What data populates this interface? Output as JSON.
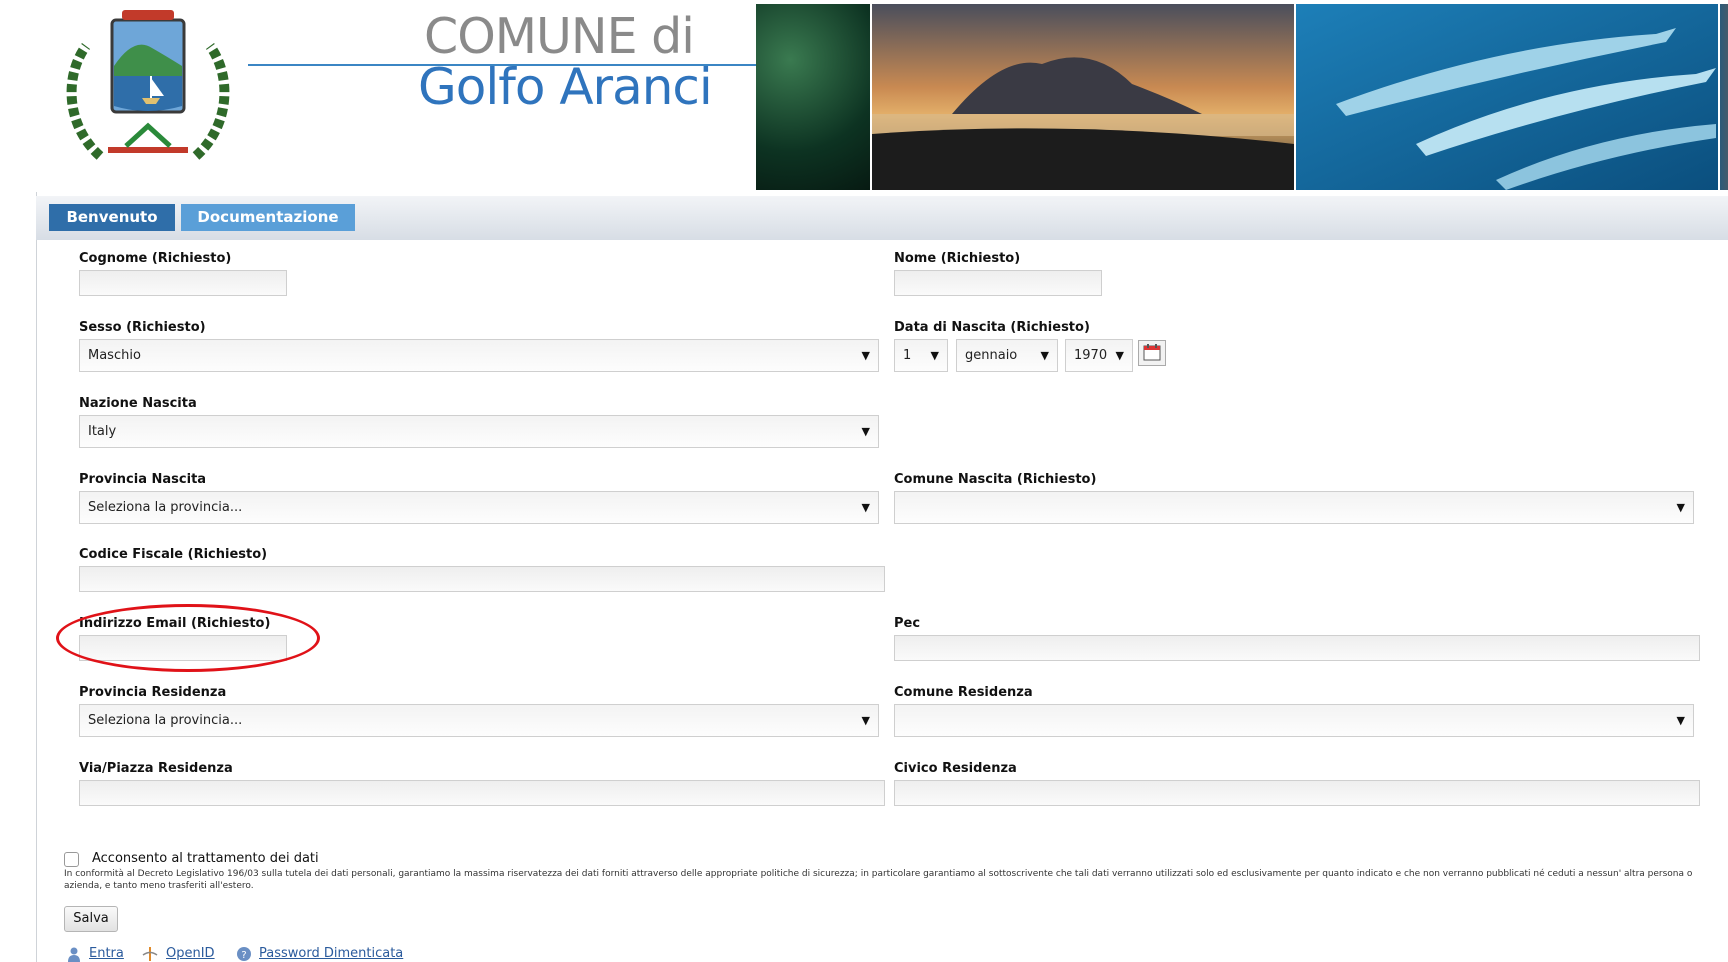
{
  "header": {
    "title_line1": "COMUNE di",
    "title_line2": "Golfo Aranci"
  },
  "nav": {
    "tabs": [
      {
        "label": "Benvenuto"
      },
      {
        "label": "Documentazione"
      }
    ]
  },
  "form": {
    "cognome_label": "Cognome (Richiesto)",
    "nome_label": "Nome (Richiesto)",
    "sesso_label": "Sesso (Richiesto)",
    "sesso_value": "Maschio",
    "data_nascita_label": "Data di Nascita (Richiesto)",
    "giorno_value": "1",
    "mese_value": "gennaio",
    "anno_value": "1970",
    "nazione_label": "Nazione Nascita",
    "nazione_value": "Italy",
    "provincia_nascita_label": "Provincia Nascita",
    "provincia_nascita_value": "Seleziona la provincia...",
    "comune_nascita_label": "Comune Nascita (Richiesto)",
    "codice_fiscale_label": "Codice Fiscale (Richiesto)",
    "email_label": "Indirizzo Email (Richiesto)",
    "pec_label": "Pec",
    "provincia_residenza_label": "Provincia Residenza",
    "provincia_residenza_value": "Seleziona la provincia...",
    "comune_residenza_label": "Comune Residenza",
    "via_label": "Via/Piazza Residenza",
    "civico_label": "Civico Residenza",
    "consent_label": "Acconsento al trattamento dei dati",
    "legal_text": "In conformità al Decreto Legislativo 196/03 sulla tutela dei dati personali, garantiamo la massima riservatezza dei dati forniti attraverso delle appropriate politiche di sicurezza; in particolare garantiamo al sottoscrivente che tali dati verranno utilizzati solo ed esclusivamente per quanto indicato e che non verranno pubblicati né ceduti a nessun' altra persona o azienda, e tanto meno trasferiti all'estero.",
    "save_label": "Salva"
  },
  "footer_links": {
    "login": "Entra",
    "openid": "OpenID",
    "password": "Password Dimenticata"
  },
  "colors": {
    "accent_blue": "#2f6ea9",
    "light_tab_blue": "#5a9fd8",
    "annotation_red": "#e01218"
  },
  "icons": {
    "calendar": "calendar-icon",
    "user": "user-icon",
    "openid": "openid-icon",
    "help": "help-icon"
  }
}
